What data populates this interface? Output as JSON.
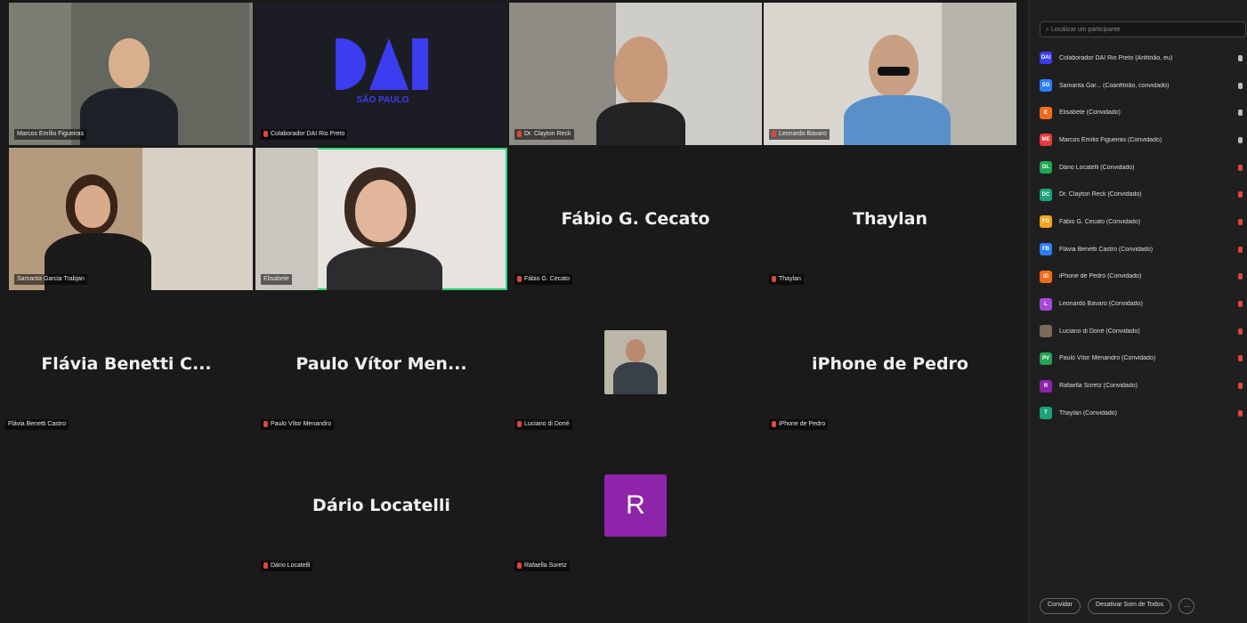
{
  "colors": {
    "accent_active": "#2ed37b",
    "muted_mic": "#e0463c",
    "avatar_r": "#8e24aa",
    "logo_blue": "#3c3cf0"
  },
  "tiles": {
    "t1": {
      "label": "Marcos Emílio Figueiras"
    },
    "t2": {
      "label": "Colaborador DAI Rio Preto",
      "logo_text": "SÃO PAULO"
    },
    "t3": {
      "label": "Dr. Clayton Reck"
    },
    "t4": {
      "label": "Leonardo Bavaro"
    },
    "t5": {
      "label": "Samanta Garcia Trabjan"
    },
    "t6": {
      "label": "Elisabete"
    },
    "t7": {
      "center": "Fábio G. Cecato",
      "label": "Fábio G. Cecato"
    },
    "t8": {
      "center": "Thaylan",
      "label": "Thaylan"
    },
    "t9": {
      "center": "Flávia Benetti C...",
      "label": "Flávia Benetti Castro"
    },
    "t10": {
      "center": "Paulo Vítor Men...",
      "label": "Paulo Vítor Menandro"
    },
    "t11": {
      "label": "Luciano di Doné"
    },
    "t12": {
      "center": "iPhone de Pedro",
      "label": "iPhone de Pedro"
    },
    "t13": {
      "center": "Dário Locatelli",
      "label": "Dário Locatelli"
    },
    "t14": {
      "avatar": "R",
      "label": "Rafaella Soretz"
    }
  },
  "panel": {
    "search_placeholder": "Localizar um participante",
    "participants": [
      {
        "initials": "DAI",
        "color": "#3c3cf0",
        "name": "Colaborador DAI Rio Preto (Anfitrião, eu)",
        "mic": "on"
      },
      {
        "initials": "SG",
        "color": "#2d7ef7",
        "name": "Samanta Gar... (Coanfitrião, convidado)",
        "mic": "on"
      },
      {
        "initials": "E",
        "color": "#f26b1d",
        "name": "Elisabete (Convidado)",
        "mic": "on"
      },
      {
        "initials": "ME",
        "color": "#e5393f",
        "name": "Marcos Emílio Figueiras (Convidado)",
        "mic": "on"
      },
      {
        "initials": "DL",
        "color": "#22a455",
        "name": "Dário Locatelli (Convidado)",
        "mic": "off"
      },
      {
        "initials": "DC",
        "color": "#1aa37a",
        "name": "Dr. Clayton Reck (Convidado)",
        "mic": "off"
      },
      {
        "initials": "FG",
        "color": "#f2a51d",
        "name": "Fábio G. Cecato (Convidado)",
        "mic": "off"
      },
      {
        "initials": "FB",
        "color": "#2d7ef7",
        "name": "Flávia Benetti Castro (Convidado)",
        "mic": "off"
      },
      {
        "initials": "iD",
        "color": "#f26b1d",
        "name": "iPhone de Pedro (Convidado)",
        "mic": "off"
      },
      {
        "initials": "L",
        "color": "#a64bd9",
        "name": "Leonardo Bavaro (Convidado)",
        "mic": "off"
      },
      {
        "initials": "",
        "color": "#7a6a5a",
        "name": "Luciano di Doné (Convidado)",
        "mic": "off"
      },
      {
        "initials": "PV",
        "color": "#22a455",
        "name": "Paulo Vítor Menandro (Convidado)",
        "mic": "off"
      },
      {
        "initials": "R",
        "color": "#8e24aa",
        "name": "Rafaella Soretz (Convidado)",
        "mic": "off"
      },
      {
        "initials": "T",
        "color": "#1aa37a",
        "name": "Thaylan (Convidado)",
        "mic": "off"
      }
    ],
    "invite": "Convidar",
    "mute_all": "Desativar Som de Todos",
    "more": "..."
  }
}
